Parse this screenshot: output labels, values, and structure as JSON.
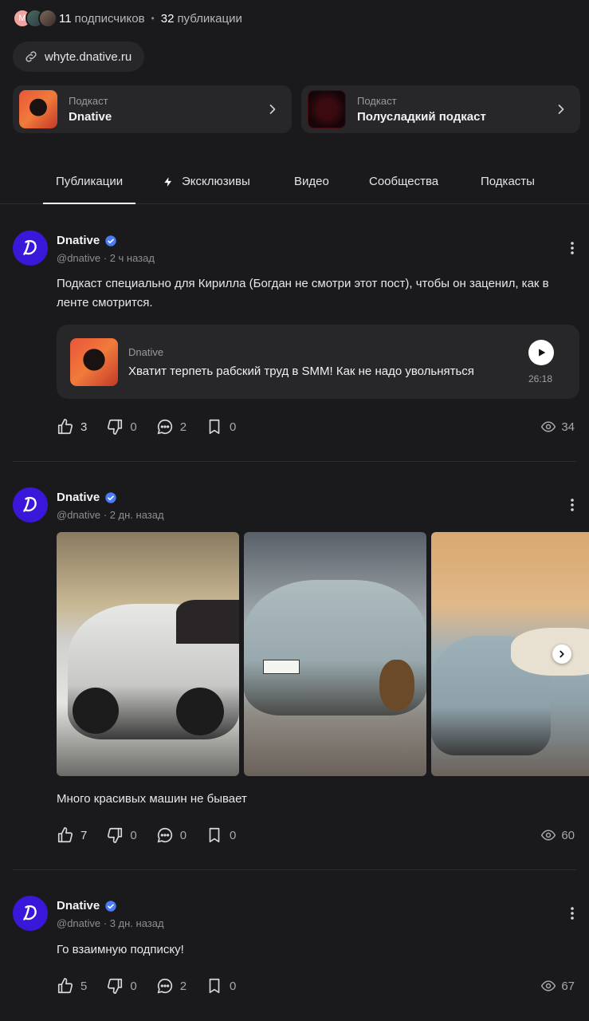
{
  "profile": {
    "followers_count": "11",
    "followers_label": "подписчиков",
    "posts_count": "32",
    "posts_label": "публикации",
    "avatar_initial": "M",
    "link": "whyte.dnative.ru"
  },
  "podcasts": [
    {
      "subtitle": "Подкаст",
      "title": "Dnative"
    },
    {
      "subtitle": "Подкаст",
      "title": "Полусладкий подкаст"
    }
  ],
  "tabs": [
    {
      "label": "Публикации",
      "active": true
    },
    {
      "label": "Эксклюзивы",
      "icon": "lightning-icon"
    },
    {
      "label": "Видео"
    },
    {
      "label": "Сообщества"
    },
    {
      "label": "Подкасты"
    }
  ],
  "posts": [
    {
      "author": "Dnative",
      "handle": "@dnative",
      "time": "2 ч назад",
      "text": "Подкаст специально для Кирилла (Богдан не смотри этот пост), чтобы он заценил, как в ленте смотрится.",
      "attachment": {
        "author": "Dnative",
        "title": "Хватит терпеть рабский труд в SMM! Как не надо увольняться",
        "duration": "26:18"
      },
      "likes": "3",
      "dislikes": "0",
      "comments": "2",
      "bookmarks": "0",
      "views": "34"
    },
    {
      "author": "Dnative",
      "handle": "@dnative",
      "time": "2 дн. назад",
      "text": "Много красивых машин не бывает",
      "likes": "7",
      "dislikes": "0",
      "comments": "0",
      "bookmarks": "0",
      "views": "60"
    },
    {
      "author": "Dnative",
      "handle": "@dnative",
      "time": "3 дн. назад",
      "text": "Го взаимную подписку!",
      "likes": "5",
      "dislikes": "0",
      "comments": "2",
      "bookmarks": "0",
      "views": "67"
    }
  ],
  "colors": {
    "background": "#1a1a1d",
    "card": "#27272a",
    "avatar_brand": "#3b17d9",
    "verified": "#4a7cf7"
  }
}
